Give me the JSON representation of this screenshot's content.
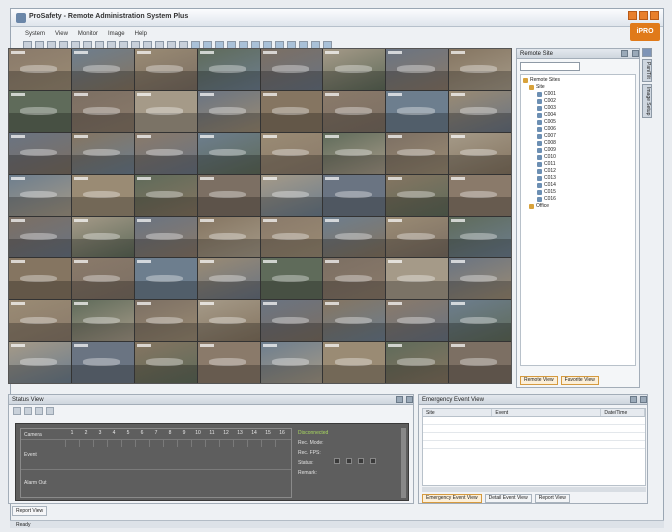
{
  "window": {
    "title": "ProSafety - Remote Administration System Plus"
  },
  "menu": [
    "System",
    "View",
    "Monitor",
    "Image",
    "Help"
  ],
  "logo": "iPRO",
  "device_panel": {
    "title": "Remote Site",
    "root": "Remote Sites",
    "site": "Site",
    "cameras": [
      "C001",
      "C002",
      "C003",
      "C004",
      "C005",
      "C006",
      "C007",
      "C008",
      "C009",
      "C010",
      "C011",
      "C012",
      "C013",
      "C014",
      "C015",
      "C016"
    ],
    "site2": "Office",
    "tabs": [
      "Remote View",
      "Favorite View"
    ]
  },
  "side_tabs": [
    "Pan/Tilt",
    "Image Setup"
  ],
  "status_panel": {
    "title": "Status View",
    "rows": [
      "Camera",
      "Event",
      "Alarm Out"
    ],
    "channels": [
      "1",
      "2",
      "3",
      "4",
      "5",
      "6",
      "7",
      "8",
      "9",
      "10",
      "11",
      "12",
      "13",
      "14",
      "15",
      "16"
    ],
    "info": [
      "Disconnected",
      "Rec. Mode:",
      "Rec. FPS:",
      "Status:",
      "",
      "Remark:"
    ]
  },
  "event_panel": {
    "title": "Emergency Event View",
    "columns": [
      "Site",
      "Event",
      "Date/Time"
    ],
    "tabs": [
      "Emergency Event View",
      "Detail Event View",
      "Report View"
    ]
  },
  "bottom_tab": "Report View",
  "statusbar": "Ready",
  "colors": {
    "accent": "#e07a1a"
  }
}
